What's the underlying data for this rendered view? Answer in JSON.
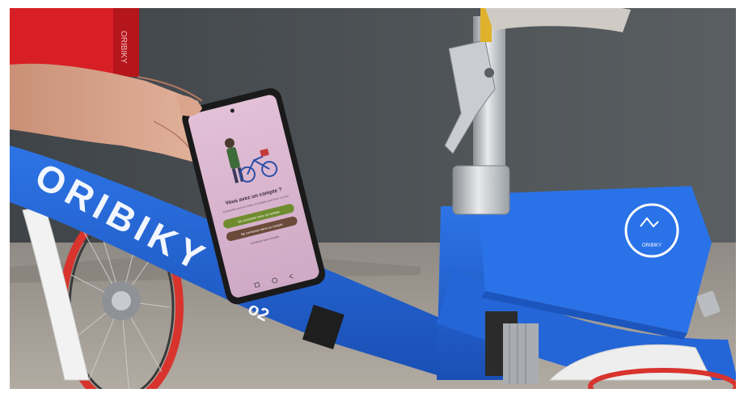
{
  "photo": {
    "frame_brand": "ORIBIKY",
    "frame_model": "o2",
    "kiosk_text": "ORIBIKY",
    "lock_badge": "ORIBIKY"
  },
  "phone": {
    "heading": "Vous avez un compte ?",
    "subtitle": "Connectez-vous ou créez un compte pour louer un vélo",
    "primary_button": "Se connecter avec un compte",
    "secondary_button": "Se connecter sans un compte",
    "footer_link": "Continuer sans compte"
  },
  "colors": {
    "frame_blue": "#1f5fd0",
    "phone_screen": "#d9b7cf",
    "primary_button": "#6f8d2e",
    "secondary_button": "#6b4a3a"
  }
}
